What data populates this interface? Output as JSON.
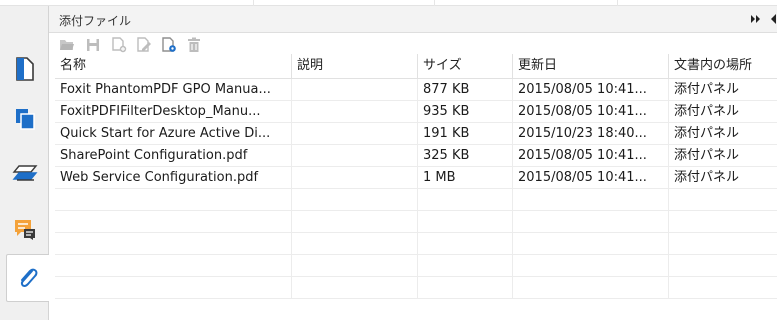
{
  "panel": {
    "title": "添付ファイル",
    "expand_icon": "double-chevron-right",
    "collapse_icon": "triangle-left"
  },
  "nav": {
    "items": [
      {
        "name": "pages-thumbnail",
        "icon": "page-icon",
        "active": false
      },
      {
        "name": "layers",
        "icon": "copy-pages-icon",
        "active": false
      },
      {
        "name": "layers-stack",
        "icon": "layers-icon",
        "active": false
      },
      {
        "name": "comments",
        "icon": "comment-icon",
        "active": false
      },
      {
        "name": "attachments",
        "icon": "paperclip-icon",
        "active": true
      }
    ]
  },
  "toolbar": {
    "buttons": [
      {
        "name": "open-attachment",
        "icon": "folder-icon"
      },
      {
        "name": "save-attachment",
        "icon": "save-icon"
      },
      {
        "name": "add-attachment",
        "icon": "add-file-icon"
      },
      {
        "name": "edit-description",
        "icon": "edit-file-icon"
      },
      {
        "name": "attachment-settings",
        "icon": "file-settings-icon"
      },
      {
        "name": "delete-attachment",
        "icon": "trash-icon"
      }
    ]
  },
  "table": {
    "columns": [
      "名称",
      "説明",
      "サイズ",
      "更新日",
      "文書内の場所"
    ],
    "rows": [
      {
        "name": "Foxit PhantomPDF GPO Manua...",
        "description": "",
        "size": "877 KB",
        "modified": "2015/08/05 10:41...",
        "location": "添付パネル"
      },
      {
        "name": "FoxitPDFIFilterDesktop_Manu...",
        "description": "",
        "size": "935 KB",
        "modified": "2015/08/05 10:41...",
        "location": "添付パネル"
      },
      {
        "name": "Quick Start for Azure Active Di...",
        "description": "",
        "size": "191 KB",
        "modified": "2015/10/23 18:40...",
        "location": "添付パネル"
      },
      {
        "name": "SharePoint Configuration.pdf",
        "description": "",
        "size": "325 KB",
        "modified": "2015/08/05 10:41...",
        "location": "添付パネル"
      },
      {
        "name": "Web Service Configuration.pdf",
        "description": "",
        "size": "1 MB",
        "modified": "2015/08/05 10:41...",
        "location": "添付パネル"
      }
    ]
  },
  "colors": {
    "accent_blue": "#1e6fc8",
    "icon_gray": "#b9b9b9",
    "comment_orange": "#f4a23a"
  }
}
